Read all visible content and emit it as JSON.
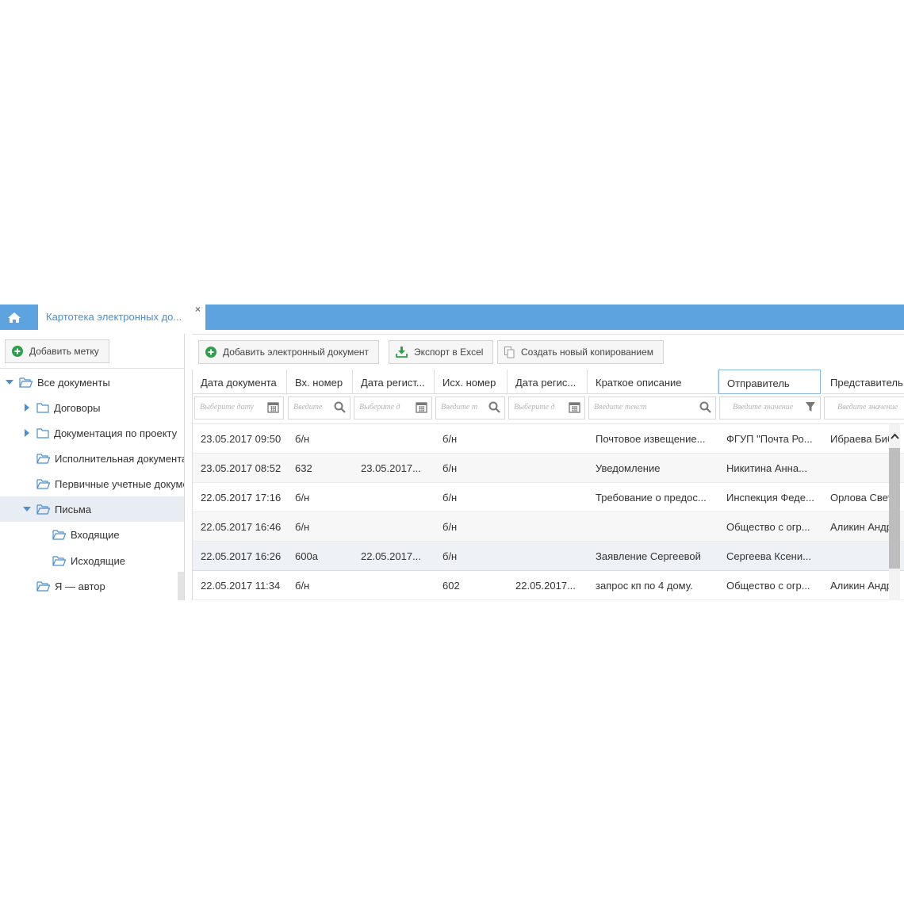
{
  "tabs": {
    "active_label": "Картотека электронных до...",
    "close_symbol": "×"
  },
  "sidebar": {
    "add_tag_label": "Добавить метку",
    "items": [
      {
        "label": "Все документы"
      },
      {
        "label": "Договоры"
      },
      {
        "label": "Документация по проекту"
      },
      {
        "label": "Исполнительная документация"
      },
      {
        "label": "Первичные учетные документы"
      },
      {
        "label": "Письма"
      },
      {
        "label": "Входящие"
      },
      {
        "label": "Исходящие"
      },
      {
        "label": "Я — автор"
      }
    ]
  },
  "toolbar": {
    "add_doc_label": "Добавить электронный документ",
    "export_label": "Экспорт в Excel",
    "copy_label": "Создать новый копированием"
  },
  "grid": {
    "columns": [
      "Дата документа",
      "Вх. номер",
      "Дата регист...",
      "Исх. номер",
      "Дата регис...",
      "Краткое описание",
      "Отправитель",
      "Представитель"
    ],
    "filters": [
      "Выберите дату",
      "Введите",
      "Выберите д",
      "Введите т",
      "Выберите д",
      "Введите текст",
      "Введите значение",
      "Введите значение"
    ],
    "rows": [
      [
        "23.05.2017 09:50",
        "б/н",
        "",
        "б/н",
        "",
        "Почтовое извещение...",
        "ФГУП \"Почта Ро...",
        "Ибраева Биб"
      ],
      [
        "23.05.2017 08:52",
        "632",
        "23.05.2017...",
        "б/н",
        "",
        "Уведомление",
        "Никитина Анна...",
        ""
      ],
      [
        "22.05.2017 17:16",
        "б/н",
        "",
        "б/н",
        "",
        "Требование о предос...",
        "Инспекция Феде...",
        "Орлова Свет"
      ],
      [
        "22.05.2017 16:46",
        "б/н",
        "",
        "б/н",
        "",
        "",
        "Общество с огр...",
        "Аликин Андр"
      ],
      [
        "22.05.2017 16:26",
        "600а",
        "22.05.2017...",
        "б/н",
        "",
        "Заявление Сергеевой",
        "Сергеева Ксени...",
        ""
      ],
      [
        "22.05.2017 11:34",
        "б/н",
        "",
        "602",
        "22.05.2017...",
        "запрос кп по 4 дому.",
        "Общество с огр...",
        "Аликин Андр"
      ]
    ]
  },
  "colors": {
    "tabbar": "#5da3e0",
    "accent_green": "#2e9e4a",
    "folder_blue": "#4a8fcf"
  }
}
